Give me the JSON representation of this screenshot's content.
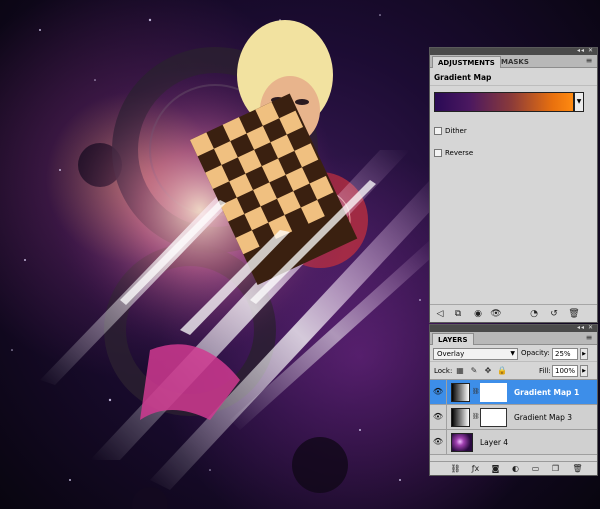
{
  "adjustments_panel": {
    "tabs": [
      "ADJUSTMENTS",
      "MASKS"
    ],
    "title": "Gradient Map",
    "gradient_colors": [
      "#2a0a55",
      "#ff8a10"
    ],
    "options": [
      {
        "label": "Dither",
        "checked": false
      },
      {
        "label": "Reverse",
        "checked": false
      }
    ],
    "footer_icons": [
      "back-arrow-icon",
      "clip-layer-icon",
      "eye-view-icon",
      "visibility-icon",
      "view-previous-icon",
      "reset-icon",
      "trash-icon"
    ]
  },
  "layers_panel": {
    "tab": "LAYERS",
    "blend_mode": "Overlay",
    "opacity_label": "Opacity:",
    "opacity_value": "25%",
    "lock_label": "Lock:",
    "fill_label": "Fill:",
    "fill_value": "100%",
    "layers": [
      {
        "name": "Gradient Map 1",
        "selected": true,
        "type": "adjustment"
      },
      {
        "name": "Gradient Map 3",
        "selected": false,
        "type": "adjustment"
      },
      {
        "name": "Layer 4",
        "selected": false,
        "type": "image"
      }
    ],
    "footer_icons": [
      "link-icon",
      "fx-icon",
      "mask-icon",
      "adjustment-icon",
      "group-icon",
      "new-layer-icon",
      "trash-icon"
    ]
  },
  "colors": {
    "panel_bg": "#d6d6d6",
    "selection_blue": "#3d8ee9",
    "canvas_purple": "#3a1a55"
  }
}
